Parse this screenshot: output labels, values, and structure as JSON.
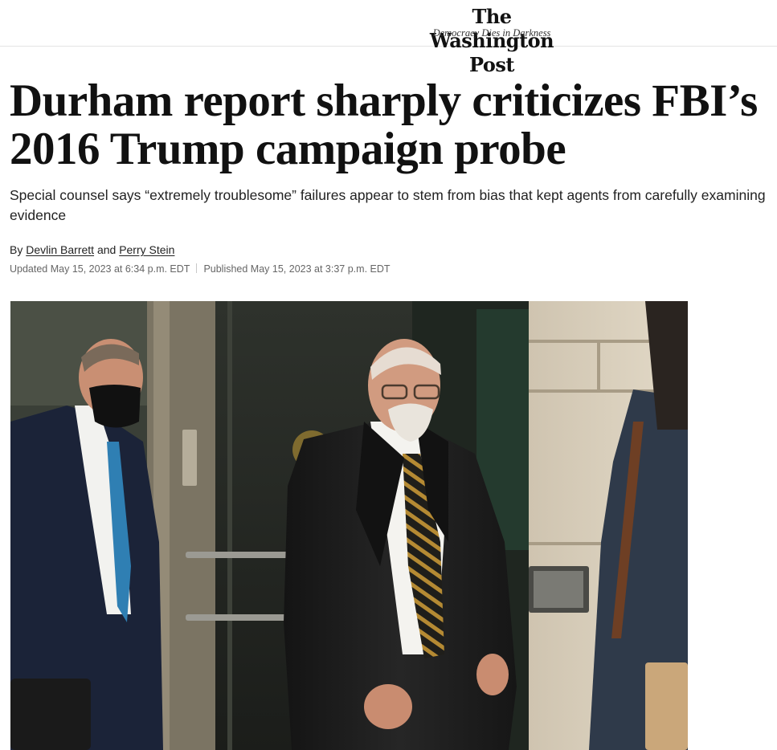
{
  "masthead": {
    "logo": "The Washington Post",
    "tagline": "Democracy Dies in Darkness"
  },
  "article": {
    "headline": "Durham report sharply criticizes FBI’s 2016 Trump campaign probe",
    "subheadline": "Special counsel says “extremely troublesome” failures appear to stem from bias that kept agents from carefully examining evidence",
    "byline": {
      "prefix": "By",
      "author1": "Devlin Barrett",
      "conjunction": "and",
      "author2": "Perry Stein"
    },
    "dates": {
      "updated": "Updated May 15, 2023 at 6:34 p.m. EDT",
      "published": "Published May 15, 2023 at 3:37 p.m. EDT"
    }
  },
  "colors": {
    "text": "#111111",
    "meta": "#666666",
    "divider": "#e4e4e4"
  }
}
